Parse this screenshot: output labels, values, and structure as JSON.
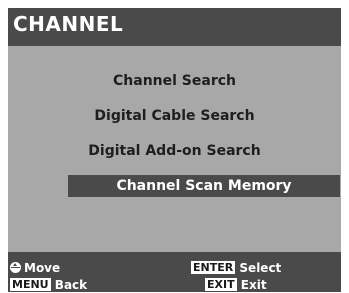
{
  "header": {
    "title": "CHANNEL"
  },
  "menu": {
    "items": [
      {
        "label": "Channel Search",
        "selected": false
      },
      {
        "label": "Digital Cable Search",
        "selected": false
      },
      {
        "label": "Digital Add-on Search",
        "selected": false
      },
      {
        "label": "Channel Scan Memory",
        "selected": true
      }
    ]
  },
  "footer": {
    "move": {
      "icon": "move-icon",
      "label": "Move"
    },
    "menu": {
      "key": "MENU",
      "label": "Back"
    },
    "enter": {
      "key": "ENTER",
      "label": "Select"
    },
    "exit": {
      "key": "EXIT",
      "label": "Exit"
    }
  },
  "colors": {
    "panel_background": "#a8a8a8",
    "bar_background": "#4a4a4a",
    "highlight_background": "#4a4a4a",
    "text_dark": "#1e1e1e",
    "text_light": "#ffffff"
  }
}
